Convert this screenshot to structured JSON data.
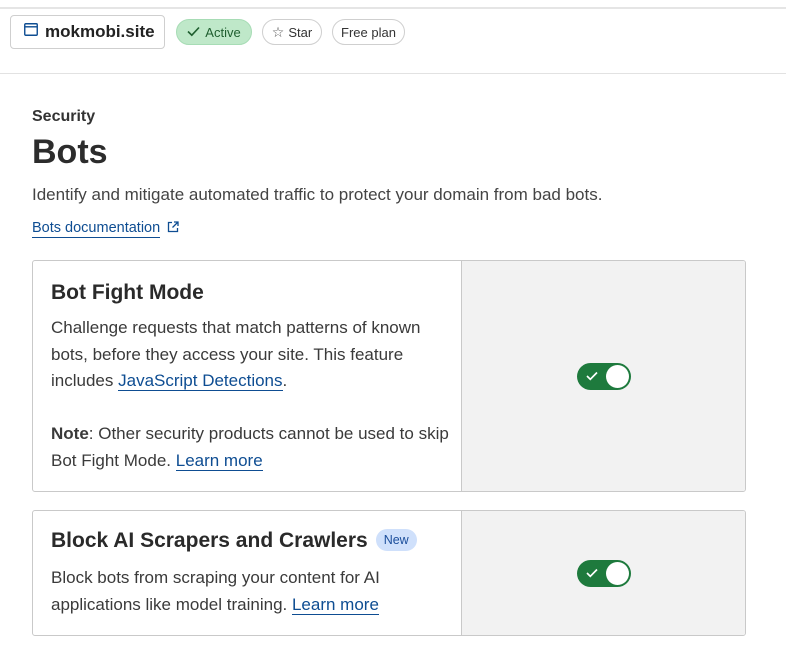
{
  "header": {
    "domain": "mokmobi.site",
    "status_badge": "Active",
    "star_label": "Star",
    "plan_badge": "Free plan"
  },
  "page": {
    "section": "Security",
    "title": "Bots",
    "description": "Identify and mitigate automated traffic to protect your domain from bad bots.",
    "doc_link": "Bots documentation"
  },
  "cards": [
    {
      "title": "Bot Fight Mode",
      "body_prefix": "Challenge requests that match patterns of known bots, before they access your site. This feature includes ",
      "body_link": "JavaScript Detections",
      "body_suffix": ".",
      "note_label": "Note",
      "note_text": ": Other security products cannot be used to skip Bot Fight Mode. ",
      "note_link": "Learn more",
      "toggle_on": true
    },
    {
      "title": "Block AI Scrapers and Crawlers",
      "badge": "New",
      "body_text": "Block bots from scraping your content for AI applications like model training. ",
      "body_link": "Learn more",
      "toggle_on": true
    }
  ],
  "colors": {
    "accent_link": "#0e4d92",
    "toggle_on": "#1e7a3d",
    "active_badge_bg": "#bfe8c9",
    "new_badge_bg": "#cfe0fb"
  },
  "icons": [
    "window-icon",
    "check-icon",
    "star-icon",
    "external-link-icon",
    "toggle-check-icon"
  ]
}
